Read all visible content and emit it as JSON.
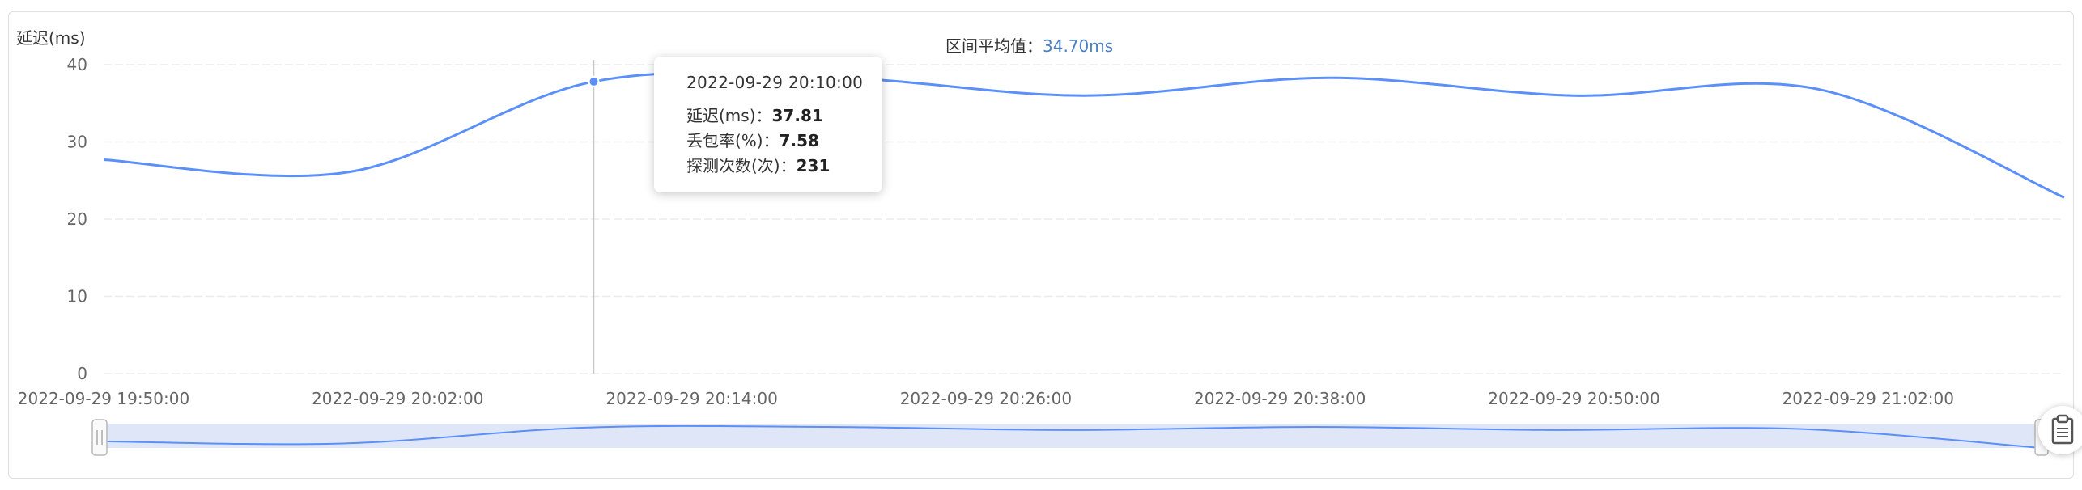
{
  "chart_data": {
    "type": "line",
    "ylabel": "延迟(ms)",
    "ylim": [
      0,
      40
    ],
    "yticks": [
      "0",
      "10",
      "20",
      "30",
      "40"
    ],
    "xticks": [
      "2022-09-29 19:50:00",
      "2022-09-29 20:02:00",
      "2022-09-29 20:14:00",
      "2022-09-29 20:26:00",
      "2022-09-29 20:38:00",
      "2022-09-29 20:50:00",
      "2022-09-29 21:02:00"
    ],
    "grid": true,
    "series": [
      {
        "color": "#5b8ff9",
        "x": [
          "2022-09-29 19:50:00",
          "2022-09-29 20:00:00",
          "2022-09-29 20:10:00",
          "2022-09-29 20:20:00",
          "2022-09-29 20:30:00",
          "2022-09-29 20:40:00",
          "2022-09-29 20:50:00",
          "2022-09-29 21:00:00",
          "2022-09-29 21:10:00"
        ],
        "values": [
          27.7,
          26.1,
          37.81,
          38.3,
          36.0,
          38.3,
          36.0,
          36.8,
          22.8
        ]
      }
    ],
    "average": {
      "label": "区间平均值：",
      "value": "34.70ms"
    },
    "tooltip": {
      "title": "2022-09-29 20:10:00",
      "rows": [
        {
          "label": "延迟(ms)：",
          "value": "37.81"
        },
        {
          "label": "丢包率(%)：",
          "value": "7.58"
        },
        {
          "label": "探测次数(次)：",
          "value": "231"
        }
      ]
    }
  },
  "colors": {
    "line": "#5b8ff9",
    "grid": "#ececec",
    "zoom_fill": "#dfe6f7",
    "avg_value": "#4a7fc1"
  },
  "toolbox": {
    "icon": "clipboard-icon"
  }
}
